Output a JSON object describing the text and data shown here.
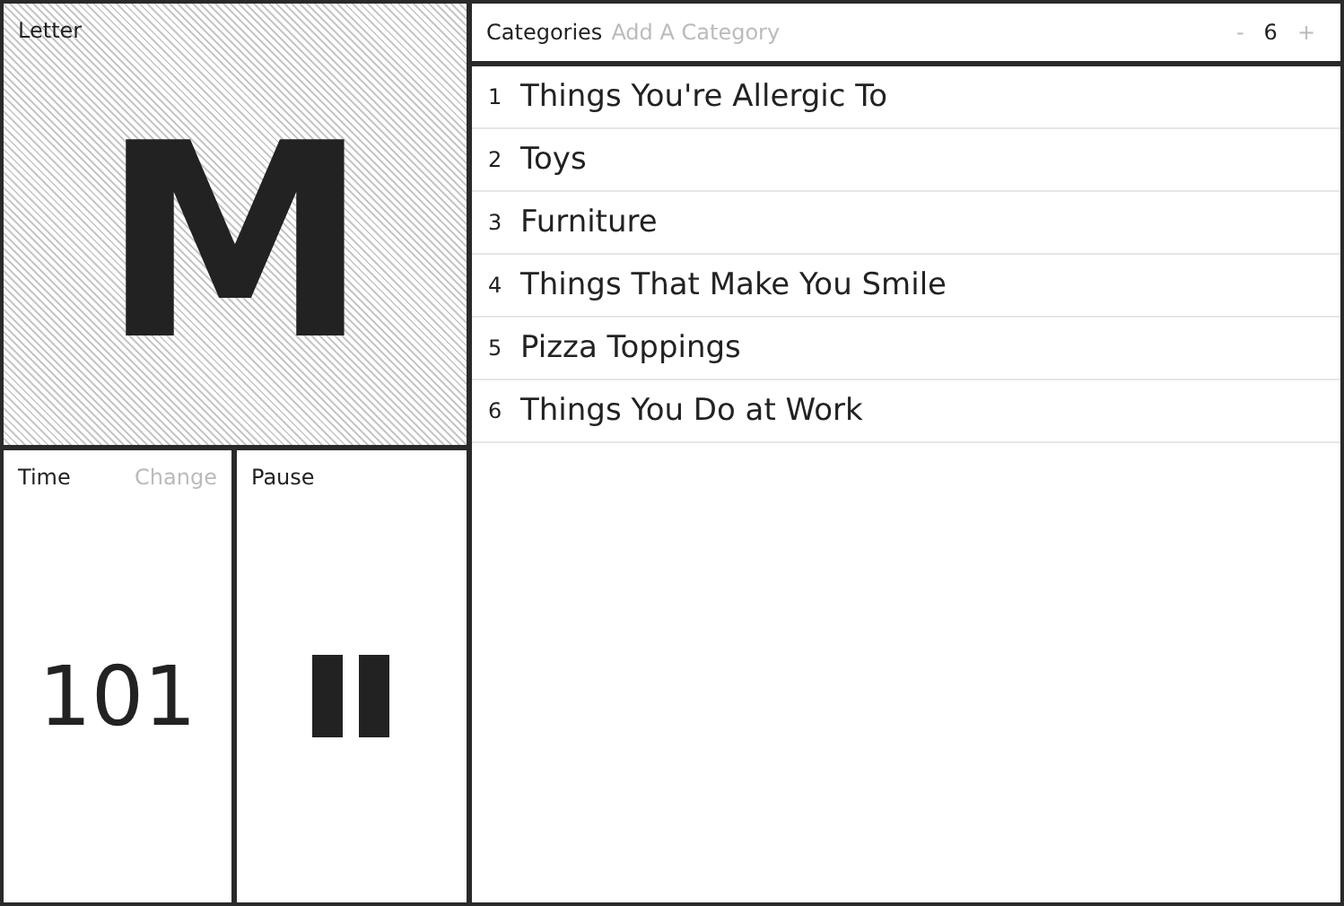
{
  "letter_panel": {
    "label": "Letter",
    "letter": "M"
  },
  "time_panel": {
    "label": "Time",
    "action": "Change",
    "value": "101"
  },
  "pause_panel": {
    "label": "Pause"
  },
  "categories": {
    "label": "Categories",
    "placeholder": "Add A Category",
    "decrement": "-",
    "count": "6",
    "increment": "+",
    "items": [
      {
        "number": "1",
        "name": "Things You're Allergic To"
      },
      {
        "number": "2",
        "name": "Toys"
      },
      {
        "number": "3",
        "name": "Furniture"
      },
      {
        "number": "4",
        "name": "Things That Make You Smile"
      },
      {
        "number": "5",
        "name": "Pizza Toppings"
      },
      {
        "number": "6",
        "name": "Things You Do at Work"
      }
    ]
  }
}
